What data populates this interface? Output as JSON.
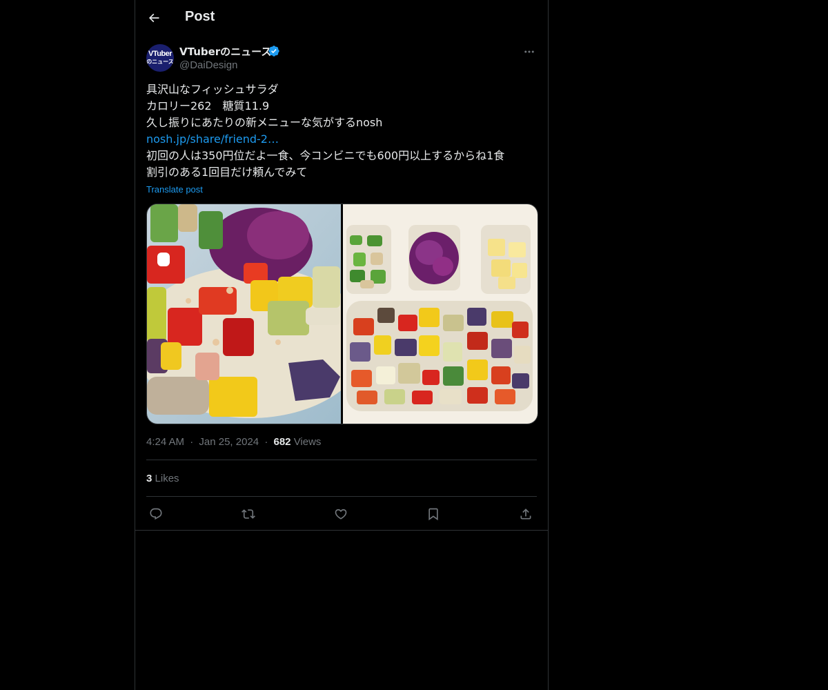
{
  "header": {
    "title": "Post",
    "back_icon": "arrow-left-icon"
  },
  "author": {
    "display_name": "VTuberのニュース",
    "handle": "@DaiDesign",
    "verified": true,
    "avatar_text_top": "VTuber",
    "avatar_text_bottom": "のニュース",
    "more_icon": "more-horizontal-icon"
  },
  "post": {
    "lines": [
      "具沢山なフィッシュサラダ",
      "カロリー262　糖質11.9",
      "久し振りにあたりの新メニューな気がするnosh"
    ],
    "link": "nosh.jp/share/friend-2…",
    "lines_after": [
      "初回の人は350円位だよ一食、今コンビニでも600円以上するからね1食",
      "割引のある1回目だけ頼んでみて"
    ],
    "translate_label": "Translate post"
  },
  "media": {
    "images": [
      {
        "description": "close-up fish salad with colorful diced vegetables"
      },
      {
        "description": "meal tray with green beans, purple cabbage, potatoes and diced vegetables"
      }
    ]
  },
  "meta": {
    "time": "4:24 AM",
    "sep1": "·",
    "date": "Jan 25, 2024",
    "sep2": "·",
    "views_count": "682",
    "views_label": "Views"
  },
  "likes": {
    "count": "3",
    "label": "Likes"
  },
  "actions": [
    {
      "name": "reply",
      "icon": "reply-icon"
    },
    {
      "name": "repost",
      "icon": "repost-icon"
    },
    {
      "name": "like",
      "icon": "heart-icon"
    },
    {
      "name": "bookmark",
      "icon": "bookmark-icon"
    },
    {
      "name": "share",
      "icon": "share-icon"
    }
  ],
  "colors": {
    "background": "#000000",
    "text": "#e7e9ea",
    "muted": "#71767b",
    "accent": "#1d9bf0",
    "border": "#2f3336"
  }
}
